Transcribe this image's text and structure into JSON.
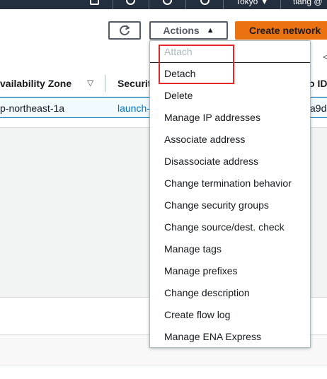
{
  "topbar": {
    "region": "Tokyo",
    "region_caret": "▼",
    "account": "tiang @"
  },
  "header": {
    "actions_label": "Actions",
    "actions_caret": "▲",
    "create_label": "Create network",
    "pager_arrow": "<"
  },
  "table": {
    "columns": [
      "vailability Zone",
      "Securit",
      "o IDs"
    ],
    "sort_icon": "▽",
    "row": [
      "p-northeast-1a",
      "launch-",
      "a9d"
    ]
  },
  "menu": {
    "items": [
      {
        "label": "Attach",
        "disabled": true
      },
      {
        "label": "Detach",
        "disabled": false
      },
      {
        "label": "Delete",
        "disabled": false
      },
      {
        "label": "Manage IP addresses",
        "disabled": false
      },
      {
        "label": "Associate address",
        "disabled": false
      },
      {
        "label": "Disassociate address",
        "disabled": false
      },
      {
        "label": "Change termination behavior",
        "disabled": false
      },
      {
        "label": "Change security groups",
        "disabled": false
      },
      {
        "label": "Change source/dest. check",
        "disabled": false
      },
      {
        "label": "Manage tags",
        "disabled": false
      },
      {
        "label": "Manage prefixes",
        "disabled": false
      },
      {
        "label": "Change description",
        "disabled": false
      },
      {
        "label": "Create flow log",
        "disabled": false
      },
      {
        "label": "Manage ENA Express",
        "disabled": false
      }
    ]
  },
  "colors": {
    "accent_orange": "#ec7211",
    "link_blue": "#0073bb",
    "highlight_red": "#e4282a",
    "topbar": "#232f3e"
  }
}
